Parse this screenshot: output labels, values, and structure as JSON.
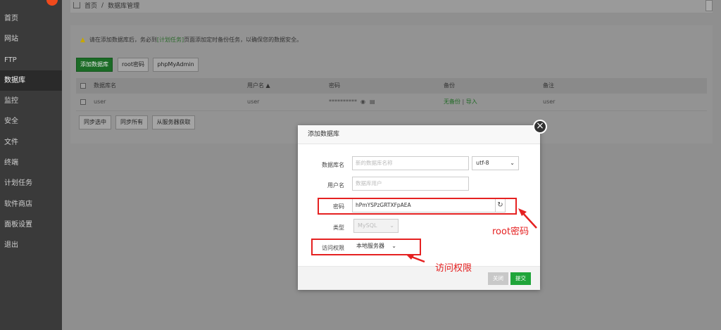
{
  "sidebar": {
    "items": [
      {
        "label": "首页"
      },
      {
        "label": "网站"
      },
      {
        "label": "FTP"
      },
      {
        "label": "数据库"
      },
      {
        "label": "监控"
      },
      {
        "label": "安全"
      },
      {
        "label": "文件"
      },
      {
        "label": "终端"
      },
      {
        "label": "计划任务"
      },
      {
        "label": "软件商店"
      },
      {
        "label": "面板设置"
      },
      {
        "label": "退出"
      }
    ],
    "active": "数据库"
  },
  "breadcrumb": {
    "home": "首页",
    "separator": "/",
    "current": "数据库管理"
  },
  "alert": {
    "before": "请在添加数据库后，务必到",
    "link": "[计划任务]",
    "after": "页面添加定时备份任务，以确保您的数据安全。"
  },
  "toolbar": {
    "add_db": "添加数据库",
    "root_password": "root密码",
    "phpmyadmin": "phpMyAdmin"
  },
  "table": {
    "headers": {
      "name": "数据库名",
      "user": "用户名 ▲",
      "password": "密码",
      "backup": "备份",
      "note": "备注"
    },
    "rows": [
      {
        "name": "user",
        "user": "user",
        "password": "**********",
        "backup_status": "无备份",
        "backup_sep": " | ",
        "import": "导入",
        "note": "user"
      }
    ]
  },
  "bottom_buttons": {
    "sync_selected": "同步选中",
    "sync_all": "同步所有",
    "fetch_from_server": "从服务器获取"
  },
  "modal": {
    "title": "添加数据库",
    "db_name_label": "数据库名",
    "db_name_placeholder": "新的数据库名称",
    "charset": "utf-8",
    "username_label": "用户名",
    "username_placeholder": "数据库用户",
    "password_label": "密码",
    "password_value": "hPmYSPzGRTXFpAEA",
    "type_label": "类型",
    "type_value": "MySQL",
    "access_label": "访问权限",
    "access_value": "本地服务器",
    "close_button": "关闭",
    "submit_button": "提交"
  },
  "annotations": {
    "root_password": "root密码",
    "access": "访问权限"
  },
  "colors": {
    "accent_green": "#20a53a",
    "annotation_red": "#e52121"
  }
}
